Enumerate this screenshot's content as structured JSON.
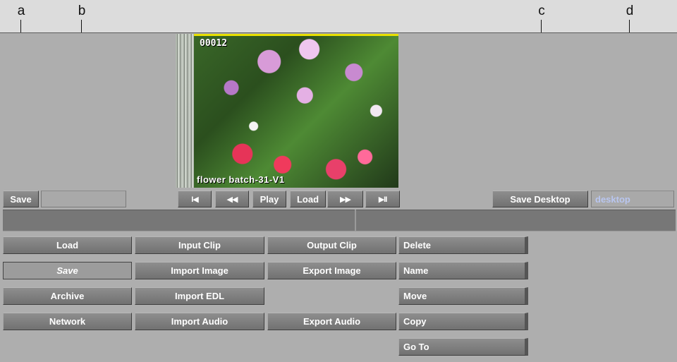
{
  "callouts": {
    "a": "a",
    "b": "b",
    "c": "c",
    "d": "d"
  },
  "viewer": {
    "timecode": "00012",
    "clip_name": "flower batch-31-V1"
  },
  "transport": {
    "first_frame_icon": "skip-to-start-icon",
    "first_frame": "I◀",
    "rewind_icon": "rewind-icon",
    "rewind": "◀◀",
    "play": "Play",
    "load": "Load",
    "forward_icon": "fast-forward-icon",
    "forward": "▶▶",
    "last_frame_icon": "play-pause-icon",
    "last_frame": "▶II"
  },
  "toolbar": {
    "save": "Save",
    "save_name_value": "",
    "save_desktop": "Save Desktop",
    "desktop_name_value": "desktop"
  },
  "menu": {
    "col1": [
      "Load",
      "Save",
      "Archive",
      "Network"
    ],
    "col2": [
      "Input Clip",
      "Import Image",
      "Import EDL",
      "Import Audio"
    ],
    "col3": [
      "Output Clip",
      "Export Image",
      "",
      "Export Audio"
    ],
    "col4": [
      "Delete",
      "Name",
      "Move",
      "Copy",
      "Go To"
    ]
  },
  "colors": {
    "panel": "#aeaeae",
    "button": "#7f7f7f",
    "field_text": "#b9c6f0",
    "viewer_marker": "#e8e000"
  }
}
